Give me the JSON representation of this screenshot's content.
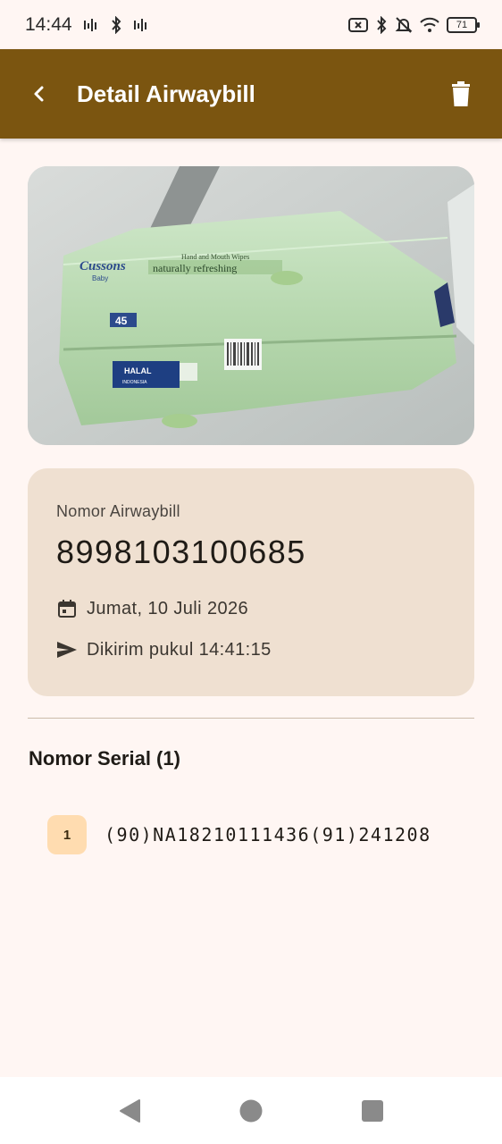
{
  "status_bar": {
    "time": "14:44",
    "battery": "71"
  },
  "app_bar": {
    "title": "Detail Airwaybill",
    "back_icon": "arrow-back-icon",
    "delete_icon": "trash-icon",
    "color": "#7b5510"
  },
  "photo": {
    "alt": "Product photo",
    "brand": "Cussons",
    "brand_sub": "Baby",
    "product_line": "Hand and Mouth Wipes",
    "tagline": "naturally refreshing",
    "count": "45",
    "halal": "HALAL",
    "halal_sub": "INDONESIA"
  },
  "airwaybill": {
    "label": "Nomor Airwaybill",
    "number": "8998103100685",
    "date": "Jumat, 10 Juli 2026",
    "sent": "Dikirim pukul 14:41:15",
    "date_icon": "calendar-icon",
    "sent_icon": "send-icon"
  },
  "serials": {
    "heading": "Nomor Serial (1)",
    "items": [
      {
        "index": "1",
        "code": "(90)NA18210111436(91)241208"
      }
    ]
  },
  "colors": {
    "background": "#fff6f3",
    "card": "#efe0d1",
    "badge": "#ffdcb0"
  }
}
